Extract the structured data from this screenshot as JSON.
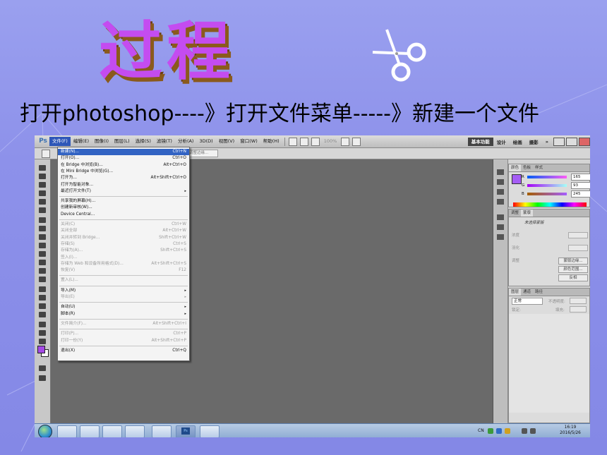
{
  "slide": {
    "title": "过程",
    "subtitle": "打开photoshop----》打开文件菜单-----》新建一个文件",
    "title_color": "#c44cf0",
    "shadow_color": "#8a5a1c",
    "background": "#8d91ea"
  },
  "photoshop": {
    "logo": "Ps",
    "menubar": [
      "文件(F)",
      "编辑(E)",
      "图像(I)",
      "图层(L)",
      "选择(S)",
      "滤镜(T)",
      "分析(A)",
      "3D(D)",
      "视图(V)",
      "窗口(W)",
      "帮助(H)"
    ],
    "zoom_level": "100%",
    "workspaces": [
      "基本功能",
      "设计",
      "绘画",
      "摄影",
      "»"
    ],
    "options_field": "调整边缘...",
    "file_menu": [
      {
        "label": "新建(N)...",
        "shortcut": "Ctrl+N",
        "highlight": true
      },
      {
        "label": "打开(O)...",
        "shortcut": "Ctrl+O"
      },
      {
        "label": "在 Bridge 中浏览(B)...",
        "shortcut": "Alt+Ctrl+O"
      },
      {
        "label": "在 Mini Bridge 中浏览(G)...",
        "shortcut": ""
      },
      {
        "label": "打开为...",
        "shortcut": "Alt+Shift+Ctrl+O"
      },
      {
        "label": "打开为智能对象...",
        "shortcut": ""
      },
      {
        "label": "最近打开文件(T)",
        "shortcut": "",
        "submenu": true
      },
      {
        "label": "共享我的屏幕(H)...",
        "shortcut": "",
        "sep_before": true
      },
      {
        "label": "创建新审核(W)...",
        "shortcut": ""
      },
      {
        "label": "Device Central...",
        "shortcut": ""
      },
      {
        "label": "关闭(C)",
        "shortcut": "Ctrl+W",
        "disabled": true,
        "sep_before": true
      },
      {
        "label": "关闭全部",
        "shortcut": "Alt+Ctrl+W",
        "disabled": true
      },
      {
        "label": "关闭并转到 Bridge...",
        "shortcut": "Shift+Ctrl+W",
        "disabled": true
      },
      {
        "label": "存储(S)",
        "shortcut": "Ctrl+S",
        "disabled": true
      },
      {
        "label": "存储为(A)...",
        "shortcut": "Shift+Ctrl+S",
        "disabled": true
      },
      {
        "label": "签入(I)...",
        "shortcut": "",
        "disabled": true
      },
      {
        "label": "存储为 Web 和设备所用格式(D)...",
        "shortcut": "Alt+Shift+Ctrl+S",
        "disabled": true
      },
      {
        "label": "恢复(V)",
        "shortcut": "F12",
        "disabled": true
      },
      {
        "label": "置入(L)...",
        "shortcut": "",
        "disabled": true,
        "sep_before": true
      },
      {
        "label": "导入(M)",
        "shortcut": "",
        "submenu": true,
        "sep_before": true
      },
      {
        "label": "导出(E)",
        "shortcut": "",
        "submenu": true,
        "disabled": true
      },
      {
        "label": "自动(U)",
        "shortcut": "",
        "submenu": true,
        "sep_before": true
      },
      {
        "label": "脚本(R)",
        "shortcut": "",
        "submenu": true
      },
      {
        "label": "文件简介(F)...",
        "shortcut": "Alt+Shift+Ctrl+I",
        "disabled": true,
        "sep_before": true
      },
      {
        "label": "打印(P)...",
        "shortcut": "Ctrl+P",
        "disabled": true,
        "sep_before": true
      },
      {
        "label": "打印一份(Y)",
        "shortcut": "Alt+Shift+Ctrl+P",
        "disabled": true
      },
      {
        "label": "退出(X)",
        "shortcut": "Ctrl+Q",
        "sep_before": true
      }
    ],
    "color_panel": {
      "tabs": [
        "颜色",
        "色板",
        "样式"
      ],
      "channels": [
        {
          "label": "R",
          "value": "165"
        },
        {
          "label": "G",
          "value": "93"
        },
        {
          "label": "B",
          "value": "245"
        }
      ],
      "foreground": "#a55df5"
    },
    "adjust_panel": {
      "tabs": [
        "调整",
        "蒙版"
      ],
      "heading": "未选择蒙版",
      "labels": [
        "浓度",
        "羽化",
        "调整"
      ],
      "buttons": [
        "蒙版边缘...",
        "颜色范围...",
        "反相"
      ]
    },
    "layers_panel": {
      "tabs": [
        "图层",
        "通道",
        "路径"
      ],
      "blend_mode": "正常",
      "opacity_label": "不透明度:",
      "lock_label": "锁定:",
      "fill_label": "填充:"
    },
    "taskbar": {
      "time": "16:19",
      "date": "2016/5/26",
      "lang": "CN"
    }
  }
}
